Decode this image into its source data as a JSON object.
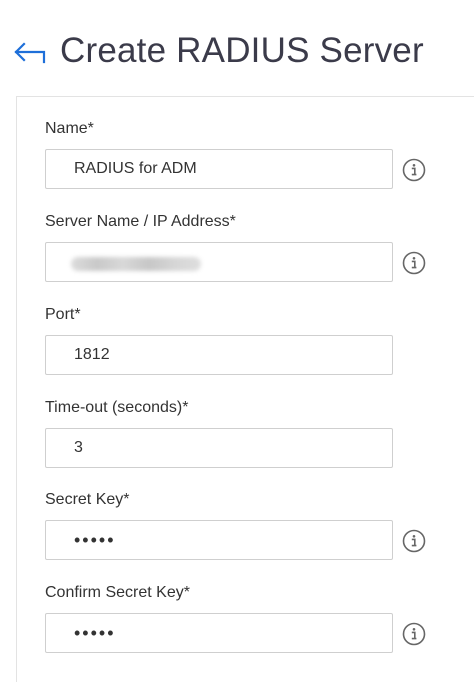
{
  "header": {
    "title": "Create RADIUS Server",
    "back_icon": "back-arrow-icon"
  },
  "form": {
    "fields": [
      {
        "label": "Name*",
        "value": "RADIUS for ADM",
        "has_info": true
      },
      {
        "label": "Server Name / IP Address*",
        "value": "",
        "blurred": true,
        "has_info": true
      },
      {
        "label": "Port*",
        "value": "1812",
        "has_info": false
      },
      {
        "label": "Time-out (seconds)*",
        "value": "3",
        "has_info": false
      },
      {
        "label": "Secret Key*",
        "value": "•••••",
        "type": "password",
        "has_info": true
      },
      {
        "label": "Confirm Secret Key*",
        "value": "•••••",
        "type": "password",
        "has_info": true
      }
    ]
  },
  "icons": {
    "info": "info-icon",
    "back": "back-arrow-icon"
  },
  "colors": {
    "accent": "#1e6fd9",
    "title": "#3b3b4a",
    "border": "#cfcfcf",
    "icon_gray": "#666666"
  }
}
